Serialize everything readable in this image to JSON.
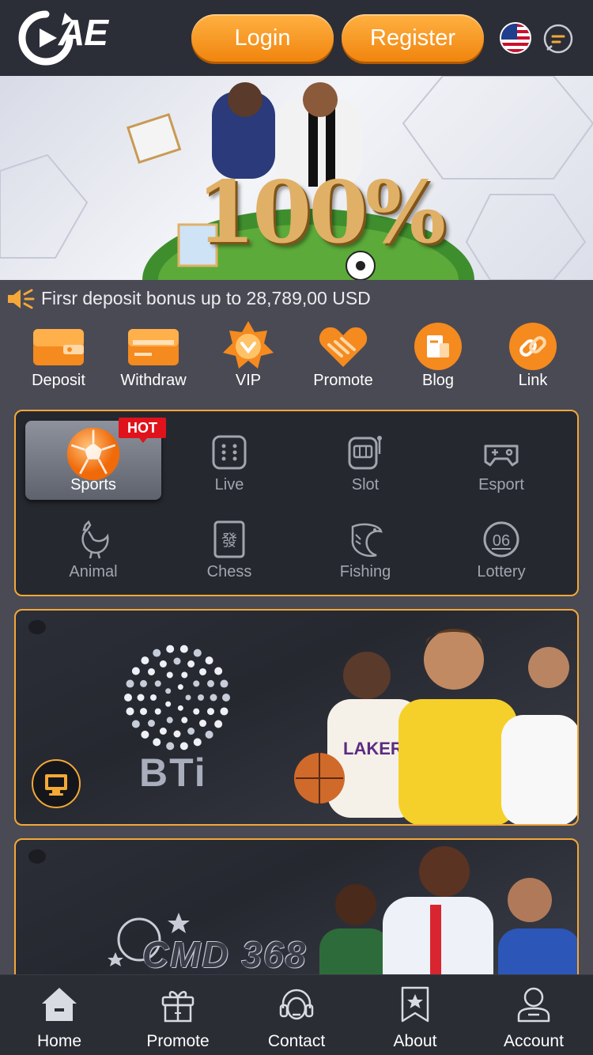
{
  "header": {
    "logo_text": "AE",
    "login_label": "Login",
    "register_label": "Register",
    "language_flag": "us-flag-icon",
    "chat_icon": "chat-icon"
  },
  "banner": {
    "title": "100%"
  },
  "marquee": {
    "text": "Firsr deposit bonus up to 28,789,00 USD",
    "icon": "speaker-icon"
  },
  "quick_links": [
    {
      "label": "Deposit",
      "icon": "wallet-icon"
    },
    {
      "label": "Withdraw",
      "icon": "card-icon"
    },
    {
      "label": "VIP",
      "icon": "vip-badge-icon"
    },
    {
      "label": "Promote",
      "icon": "handshake-icon"
    },
    {
      "label": "Blog",
      "icon": "blog-icon"
    },
    {
      "label": "Link",
      "icon": "link-icon"
    }
  ],
  "categories": {
    "hot_badge": "HOT",
    "active": "Sports",
    "items": [
      {
        "label": "Sports",
        "icon": "soccer-ball-icon"
      },
      {
        "label": "Live",
        "icon": "dice-icon"
      },
      {
        "label": "Slot",
        "icon": "slot-machine-icon"
      },
      {
        "label": "Esport",
        "icon": "gamepad-icon"
      },
      {
        "label": "Animal",
        "icon": "rooster-icon"
      },
      {
        "label": "Chess",
        "icon": "mahjong-tile-icon"
      },
      {
        "label": "Fishing",
        "icon": "fish-icon"
      },
      {
        "label": "Lottery",
        "icon": "lottery-ball-icon"
      }
    ]
  },
  "providers": [
    {
      "name": "BTi",
      "icon": "desktop-icon"
    },
    {
      "name": "CMD 368"
    }
  ],
  "bottom_nav": [
    {
      "label": "Home",
      "icon": "home-icon"
    },
    {
      "label": "Promote",
      "icon": "gift-icon"
    },
    {
      "label": "Contact",
      "icon": "headset-icon"
    },
    {
      "label": "About",
      "icon": "bookmark-star-icon"
    },
    {
      "label": "Account",
      "icon": "user-icon"
    }
  ],
  "colors": {
    "accent": "#f3a838",
    "header_bg": "#2b2e37",
    "page_bg": "#4a4a54",
    "hot": "#e0121b"
  }
}
